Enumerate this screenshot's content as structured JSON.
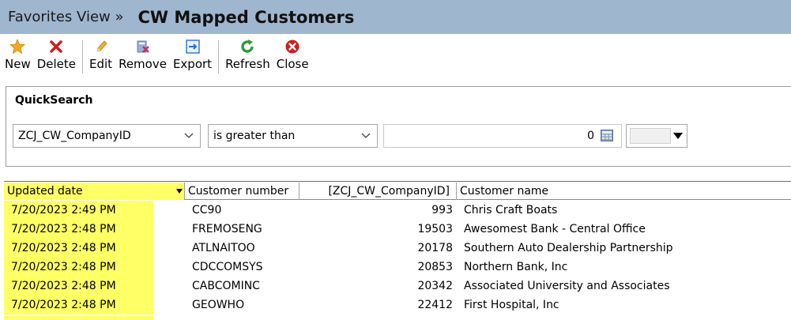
{
  "title_bar": {
    "breadcrumb": "Favorites View »",
    "title": "CW Mapped Customers"
  },
  "toolbar": {
    "buttons": [
      {
        "label": "New",
        "icon": "star-icon",
        "color": "#f5a623"
      },
      {
        "label": "Delete",
        "icon": "x-icon",
        "color": "#c8201f"
      },
      {
        "label": "Edit",
        "icon": "pencil-icon",
        "color": "#e0a020"
      },
      {
        "label": "Remove",
        "icon": "remove-icon",
        "color": "#c03060"
      },
      {
        "label": "Export",
        "icon": "export-icon",
        "color": "#2f6fc6"
      },
      {
        "label": "Refresh",
        "icon": "refresh-icon",
        "color": "#2e9a3a"
      },
      {
        "label": "Close",
        "icon": "close-circle-icon",
        "color": "#c8201f"
      }
    ]
  },
  "quicksearch": {
    "label": "QuickSearch",
    "field": "ZCJ_CW_CompanyID",
    "operator": "is greater than",
    "value": "0"
  },
  "grid": {
    "columns": [
      "Updated date",
      "Customer number",
      "[ZCJ_CW_CompanyID]",
      "Customer name"
    ],
    "sorted_column": "Updated date",
    "highlight_color": "#ffff66",
    "rows": [
      {
        "updated": "7/20/2023 2:49 PM",
        "number": "CC90",
        "company_id": "993",
        "name": "Chris Craft Boats"
      },
      {
        "updated": "7/20/2023 2:48 PM",
        "number": "FREMOSENG",
        "company_id": "19503",
        "name": "Awesomest Bank - Central Office"
      },
      {
        "updated": "7/20/2023 2:48 PM",
        "number": "ATLNAITOO",
        "company_id": "20178",
        "name": "Southern Auto Dealership Partnership"
      },
      {
        "updated": "7/20/2023 2:48 PM",
        "number": "CDCCOMSYS",
        "company_id": "20853",
        "name": "Northern Bank, Inc"
      },
      {
        "updated": "7/20/2023 2:48 PM",
        "number": "CABCOMINC",
        "company_id": "20342",
        "name": "Associated University and Associates"
      },
      {
        "updated": "7/20/2023 2:48 PM",
        "number": "GEOWHO",
        "company_id": "22412",
        "name": "First Hospital, Inc"
      }
    ]
  }
}
